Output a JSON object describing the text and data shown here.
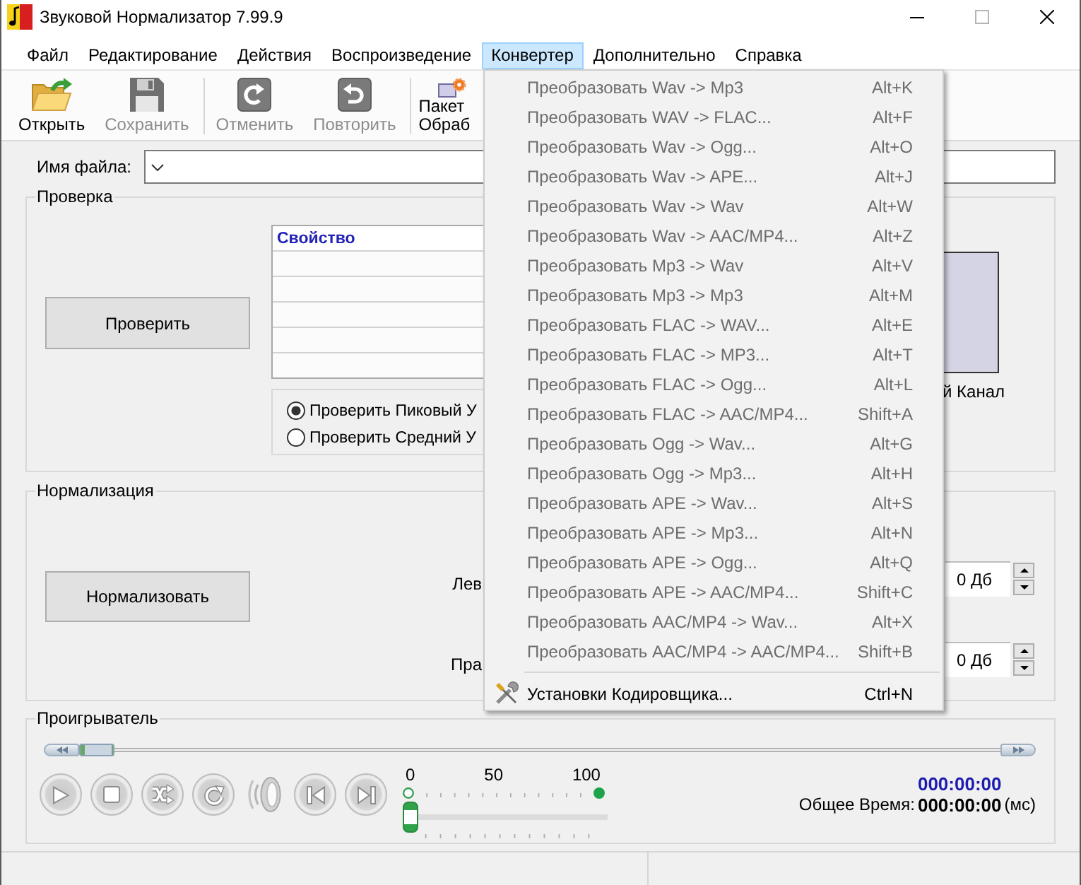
{
  "window": {
    "title": "Звуковой Нормализатор 7.99.9"
  },
  "menu_bar": [
    {
      "label": "Файл",
      "selected": false
    },
    {
      "label": "Редактирование",
      "selected": false
    },
    {
      "label": "Действия",
      "selected": false
    },
    {
      "label": "Воспроизведение",
      "selected": false
    },
    {
      "label": "Конвертер",
      "selected": true
    },
    {
      "label": "Дополнительно",
      "selected": false
    },
    {
      "label": "Справка",
      "selected": false
    }
  ],
  "toolbar": {
    "groups": [
      {
        "buttons": [
          {
            "kind": "open",
            "label": "Открыть",
            "disabled": false
          },
          {
            "kind": "save",
            "label": "Сохранить",
            "disabled": true
          }
        ]
      },
      {
        "buttons": [
          {
            "kind": "undo",
            "label": "Отменить",
            "disabled": true
          },
          {
            "kind": "redo",
            "label": "Повторить",
            "disabled": true
          }
        ]
      },
      {
        "buttons": [
          {
            "kind": "batch",
            "label": "Пакет",
            "second_line": "Обраб",
            "disabled": false
          }
        ]
      }
    ]
  },
  "file_name": {
    "label": "Имя файла:"
  },
  "check_group": {
    "title": "Проверка",
    "button": "Проверить",
    "table": {
      "columns": [
        "Свойство"
      ]
    },
    "options": [
      {
        "label": "Проверить Пиковый У",
        "selected": true
      },
      {
        "label": "Проверить Средний У",
        "selected": false
      }
    ],
    "channel_label": "й Канал"
  },
  "normalize_group": {
    "title": "Нормализация",
    "button": "Нормализовать",
    "fields": [
      {
        "label": "Лев",
        "value": "0 Дб"
      },
      {
        "label": "Пра",
        "value": "0 Дб"
      }
    ]
  },
  "player": {
    "title": "Проигрыватель",
    "seek": {
      "level": 0
    },
    "volume": {
      "level": 0,
      "scale": [
        "0",
        "50",
        "100"
      ]
    },
    "current_time": "000:00:00",
    "total_label": "Общее Время:",
    "total_time": "000:00:00",
    "unit": "(мс)"
  },
  "converter_menu": {
    "sections": [
      {
        "items": [
          {
            "kind": "plain",
            "label": "Преобразовать Wav -> Mp3",
            "shortcut": "Alt+K",
            "disabled": true
          },
          {
            "kind": "plain",
            "label": "Преобразовать WAV -> FLAC...",
            "shortcut": "Alt+F",
            "disabled": true
          },
          {
            "kind": "plain",
            "label": "Преобразовать Wav -> Ogg...",
            "shortcut": "Alt+O",
            "disabled": true
          },
          {
            "kind": "plain",
            "label": "Преобразовать Wav -> APE...",
            "shortcut": "Alt+J",
            "disabled": true
          },
          {
            "kind": "plain",
            "label": "Преобразовать Wav -> Wav",
            "shortcut": "Alt+W",
            "disabled": true
          },
          {
            "kind": "plain",
            "label": "Преобразовать Wav -> AAC/MP4...",
            "shortcut": "Alt+Z",
            "disabled": true
          },
          {
            "kind": "plain",
            "label": "Преобразовать Mp3 -> Wav",
            "shortcut": "Alt+V",
            "disabled": true
          },
          {
            "kind": "plain",
            "label": "Преобразовать Mp3 -> Mp3",
            "shortcut": "Alt+M",
            "disabled": true
          },
          {
            "kind": "plain",
            "label": "Преобразовать FLAC -> WAV...",
            "shortcut": "Alt+E",
            "disabled": true
          },
          {
            "kind": "plain",
            "label": "Преобразовать FLAC -> MP3...",
            "shortcut": "Alt+T",
            "disabled": true
          },
          {
            "kind": "plain",
            "label": "Преобразовать FLAC -> Ogg...",
            "shortcut": "Alt+L",
            "disabled": true
          },
          {
            "kind": "plain",
            "label": "Преобразовать FLAC -> AAC/MP4...",
            "shortcut": "Shift+A",
            "disabled": true
          },
          {
            "kind": "plain",
            "label": "Преобразовать Ogg -> Wav...",
            "shortcut": "Alt+G",
            "disabled": true
          },
          {
            "kind": "plain",
            "label": "Преобразовать Ogg -> Mp3...",
            "shortcut": "Alt+H",
            "disabled": true
          },
          {
            "kind": "plain",
            "label": "Преобразовать APE -> Wav...",
            "shortcut": "Alt+S",
            "disabled": true
          },
          {
            "kind": "plain",
            "label": "Преобразовать APE -> Mp3...",
            "shortcut": "Alt+N",
            "disabled": true
          },
          {
            "kind": "plain",
            "label": "Преобразовать APE -> Ogg...",
            "shortcut": "Alt+Q",
            "disabled": true
          },
          {
            "kind": "plain",
            "label": "Преобразовать APE -> AAC/MP4...",
            "shortcut": "Shift+C",
            "disabled": true
          },
          {
            "kind": "plain",
            "label": "Преобразовать AAC/MP4 -> Wav...",
            "shortcut": "Alt+X",
            "disabled": true
          },
          {
            "kind": "plain",
            "label": "Преобразовать AAC/MP4 -> AAC/MP4...",
            "shortcut": "Shift+B",
            "disabled": true
          }
        ]
      },
      {
        "items": [
          {
            "kind": "tools",
            "label": "Установки Кодировщика...",
            "shortcut": "Ctrl+N",
            "disabled": false
          }
        ]
      }
    ]
  }
}
